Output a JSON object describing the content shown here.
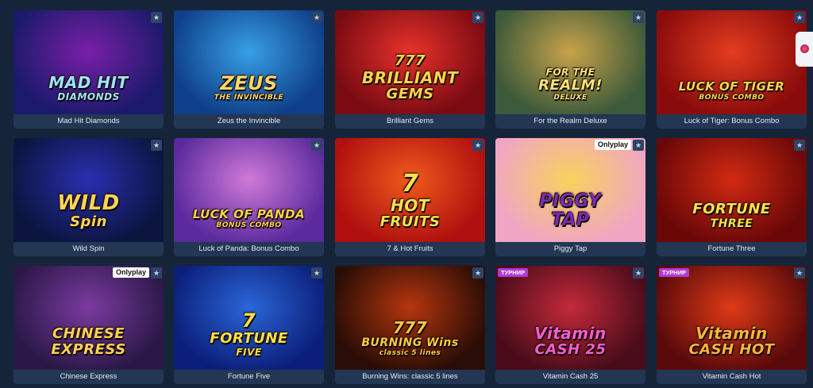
{
  "games": [
    {
      "title": "Mad Hit Diamonds",
      "art_lines": [
        "MAD HIT",
        "DIAMONDS"
      ],
      "bg": [
        "#1b1a6b",
        "#7a1fa8"
      ],
      "art_color": "#9fe3ff"
    },
    {
      "title": "Zeus the Invincible",
      "art_lines": [
        "ZEUS",
        "THE INVINCIBLE"
      ],
      "bg": [
        "#0f3f8a",
        "#38a0e6"
      ],
      "art_color": "#ffd76a"
    },
    {
      "title": "Brilliant Gems",
      "art_lines": [
        "777",
        "BRILLIANT",
        "GEMS"
      ],
      "bg": [
        "#7a0b12",
        "#e8322b"
      ],
      "art_color": "#ffd34d"
    },
    {
      "title": "For the Realm Deluxe",
      "art_lines": [
        "FOR THE",
        "REALM!",
        "DELUXE"
      ],
      "bg": [
        "#3d5a3a",
        "#c8a24a"
      ],
      "art_color": "#ffe27a"
    },
    {
      "title": "Luck of Tiger: Bonus Combo",
      "art_lines": [
        "LUCK OF TIGER",
        "BONUS COMBO"
      ],
      "bg": [
        "#8a0b0b",
        "#e43d20"
      ],
      "art_color": "#ffd44a"
    },
    {
      "title": "Wild Spin",
      "art_lines": [
        "WILD",
        "Spin"
      ],
      "bg": [
        "#0b1540",
        "#2a2fb0"
      ],
      "art_color": "#ffd35a"
    },
    {
      "title": "Luck of Panda: Bonus Combo",
      "art_lines": [
        "LUCK OF PANDA",
        "BONUS COMBO"
      ],
      "bg": [
        "#5b2a9e",
        "#d07ad8"
      ],
      "art_color": "#ffd24a"
    },
    {
      "title": "7 & Hot Fruits",
      "art_lines": [
        "7",
        "HOT",
        "FRUITS"
      ],
      "bg": [
        "#b0100f",
        "#f05a1c"
      ],
      "art_color": "#ffe14a"
    },
    {
      "title": "Piggy Tap",
      "art_lines": [
        "PIGGY",
        "TAP"
      ],
      "bg": [
        "#f0a5c4",
        "#f7d25c"
      ],
      "art_color": "#7b2bb0"
    },
    {
      "title": "Fortune Three",
      "art_lines": [
        "FORTUNE",
        "THREE"
      ],
      "bg": [
        "#6a0808",
        "#d32a12"
      ],
      "art_color": "#ffe04a"
    },
    {
      "title": "Chinese Express",
      "art_lines": [
        "CHINESE",
        "EXPRESS"
      ],
      "bg": [
        "#2b1848",
        "#7b3ba0"
      ],
      "art_color": "#ffcf5a"
    },
    {
      "title": "Fortune Five",
      "art_lines": [
        "7",
        "FORTUNE",
        "FIVE"
      ],
      "bg": [
        "#0b1f7a",
        "#2b66d8"
      ],
      "art_color": "#ffe04a"
    },
    {
      "title": "Burning Wins: classic 5 lines",
      "art_lines": [
        "777",
        "BURNING Wins",
        "classic 5 lines"
      ],
      "bg": [
        "#2a0d06",
        "#b6360e"
      ],
      "art_color": "#ffcb3a"
    },
    {
      "title": "Vitamin Cash 25",
      "art_lines": [
        "Vitamin",
        "CASH 25"
      ],
      "bg": [
        "#4a0c1a",
        "#c42a3a"
      ],
      "art_color": "#ff5bd1"
    },
    {
      "title": "Vitamin Cash Hot",
      "art_lines": [
        "Vitamin",
        "CASH HOT"
      ],
      "bg": [
        "#5a0a0a",
        "#e03a17"
      ],
      "art_color": "#ffb33a"
    }
  ],
  "badges": {
    "provider_onlyplay": "Onlyplay",
    "tournament": "ТУРНИР"
  },
  "icons": {
    "favorite": "star-icon"
  },
  "colors": {
    "page_bg": "#16243a",
    "card_bg": "#233653",
    "caption_text": "#e6ebf3",
    "tournament_badge": "#b23ad6"
  }
}
